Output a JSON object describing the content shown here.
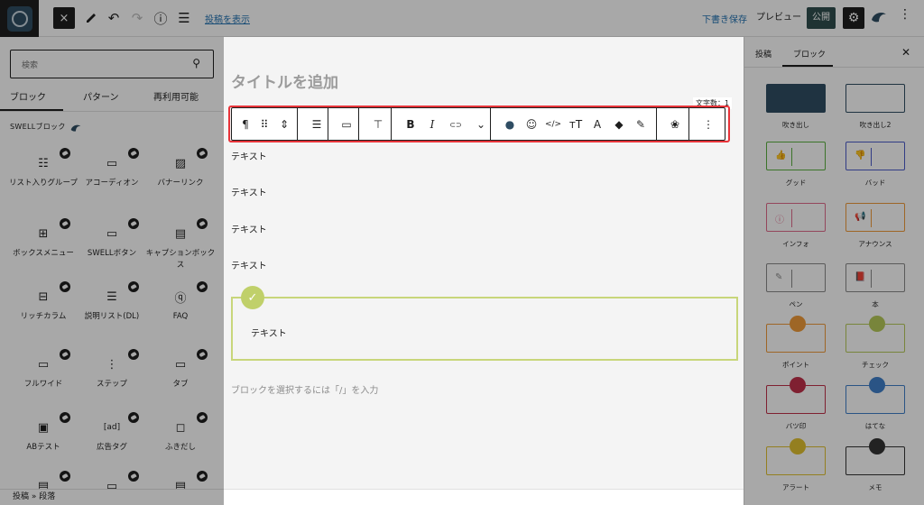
{
  "topbar": {
    "close_icon": "×",
    "view_post": "投稿を表示",
    "draft_save": "下書き保存",
    "preview": "プレビュー",
    "publish": "公開",
    "settings_icon": "gear-icon"
  },
  "inserter": {
    "search_placeholder": "検索",
    "tabs": [
      "ブロック",
      "パターン",
      "再利用可能"
    ],
    "category": "SWELLブロック",
    "blocks": [
      {
        "label": "リスト入りグループ",
        "icon": "☷",
        "swell": true
      },
      {
        "label": "アコーディオン",
        "icon": "▭",
        "swell": true
      },
      {
        "label": "バナーリンク",
        "icon": "▨",
        "swell": true
      },
      {
        "label": "ボックスメニュー",
        "icon": "⊞",
        "swell": true
      },
      {
        "label": "SWELLボタン",
        "icon": "▭",
        "swell": true
      },
      {
        "label": "キャプションボックス",
        "icon": "▤",
        "swell": true
      },
      {
        "label": "リッチカラム",
        "icon": "⊟",
        "swell": true
      },
      {
        "label": "説明リスト(DL)",
        "icon": "☰",
        "swell": true
      },
      {
        "label": "FAQ",
        "icon": "ⓠ",
        "swell": true
      },
      {
        "label": "フルワイド",
        "icon": "▭",
        "swell": true
      },
      {
        "label": "ステップ",
        "icon": "⋮",
        "swell": true
      },
      {
        "label": "タブ",
        "icon": "▭",
        "swell": true
      },
      {
        "label": "ABテスト",
        "icon": "▣",
        "swell": true
      },
      {
        "label": "広告タグ",
        "icon": "[ad]",
        "swell": true
      },
      {
        "label": "ふきだし",
        "icon": "◻",
        "swell": true
      },
      {
        "label": "",
        "icon": "▤",
        "swell": true
      },
      {
        "label": "",
        "icon": "▭",
        "swell": true
      },
      {
        "label": "",
        "icon": "▤",
        "swell": true
      }
    ]
  },
  "breadcrumb": "投稿 » 段落",
  "editor": {
    "title_placeholder": "タイトルを追加",
    "word_count": "文字数：1",
    "toolbar": [
      {
        "name": "paragraph-icon",
        "glyph": "¶"
      },
      {
        "name": "drag-handle-icon",
        "glyph": "⠿"
      },
      {
        "name": "move-updown-icon",
        "glyph": "⇕"
      },
      {
        "name": "align-icon",
        "glyph": "☰"
      },
      {
        "name": "device-control-icon",
        "glyph": "▭"
      },
      {
        "name": "margin-icon",
        "glyph": "⊤"
      },
      {
        "name": "bold-icon",
        "glyph": "B"
      },
      {
        "name": "italic-icon",
        "glyph": "I"
      },
      {
        "name": "link-icon",
        "glyph": "⊂⊃"
      },
      {
        "name": "chevron-down-icon",
        "glyph": "⌄"
      },
      {
        "name": "swell-icon",
        "glyph": "●"
      },
      {
        "name": "emoji-icon",
        "glyph": "☺"
      },
      {
        "name": "code-icon",
        "glyph": "</>"
      },
      {
        "name": "font-size-icon",
        "glyph": "тT"
      },
      {
        "name": "text-color-icon",
        "glyph": "A"
      },
      {
        "name": "highlighter-icon",
        "glyph": "◆"
      },
      {
        "name": "underline-marker-icon",
        "glyph": "✎"
      },
      {
        "name": "paw-icon",
        "glyph": "❀"
      },
      {
        "name": "more-options-icon",
        "glyph": "⋮"
      }
    ],
    "paragraphs": [
      "テキスト",
      "テキスト",
      "テキスト",
      "テキスト"
    ],
    "capbox_text": "テキスト",
    "append_hint": "ブロックを選択するには「/」を入力"
  },
  "sidebar": {
    "tabs": [
      "投稿",
      "ブロック"
    ],
    "styles": [
      {
        "label": "吹き出し",
        "border": "#2f4d63",
        "fill": "#2f4d63"
      },
      {
        "label": "吹き出し2",
        "border": "#2f4d63",
        "fill": "#ffffff"
      },
      {
        "label": "グッド",
        "border": "#5aaf3f",
        "fill": "#ffffff",
        "icon": "👍"
      },
      {
        "label": "バッド",
        "border": "#4a5bc9",
        "fill": "#ffffff",
        "icon": "👎"
      },
      {
        "label": "インフォ",
        "border": "#e06a8c",
        "fill": "#ffffff",
        "icon": "ⓘ"
      },
      {
        "label": "アナウンス",
        "border": "#f09a3a",
        "fill": "#ffffff",
        "icon": "📢"
      },
      {
        "label": "ペン",
        "border": "#888888",
        "fill": "#ffffff",
        "icon": "✎"
      },
      {
        "label": "本",
        "border": "#888888",
        "fill": "#ffffff",
        "icon": "📕"
      },
      {
        "label": "ポイント",
        "border": "#f09a3a",
        "fill": "#ffffff",
        "dot": "#f09a3a"
      },
      {
        "label": "チェック",
        "border": "#b6c95a",
        "fill": "#ffffff",
        "dot": "#b6c95a"
      },
      {
        "label": "バツ印",
        "border": "#c0314a",
        "fill": "#ffffff",
        "dot": "#c0314a"
      },
      {
        "label": "はてな",
        "border": "#3f7fc9",
        "fill": "#ffffff",
        "dot": "#3f7fc9"
      },
      {
        "label": "アラート",
        "border": "#e0c030",
        "fill": "#ffffff",
        "dot": "#e0c030"
      },
      {
        "label": "メモ",
        "border": "#333333",
        "fill": "#ffffff",
        "dot": "#333333"
      }
    ]
  }
}
